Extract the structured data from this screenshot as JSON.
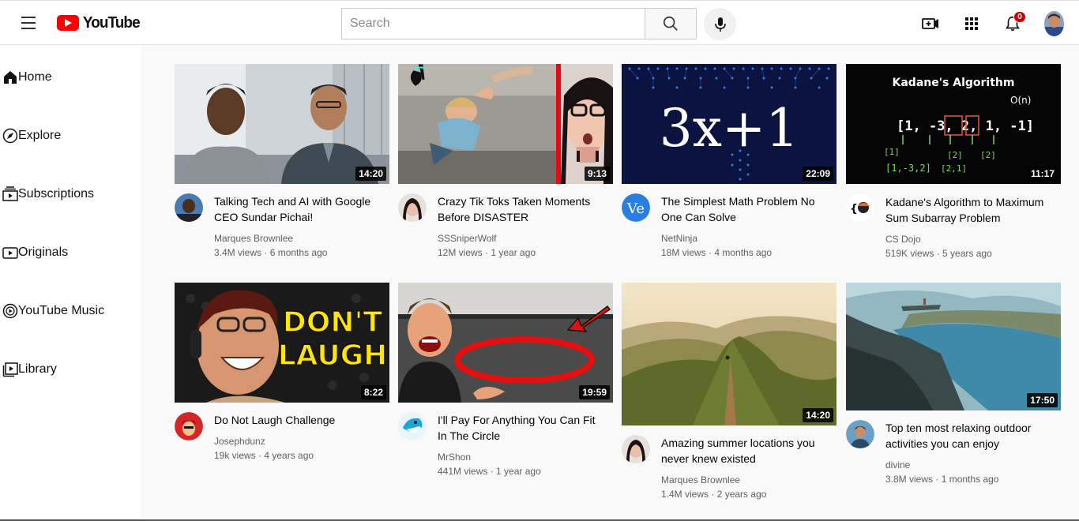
{
  "header": {
    "logo_text": "YouTube",
    "search_placeholder": "Search",
    "notification_count": "0"
  },
  "sidebar": {
    "items": [
      {
        "label": "Home",
        "icon": "home-icon"
      },
      {
        "label": "Explore",
        "icon": "compass-icon"
      },
      {
        "label": "Subscriptions",
        "icon": "subscriptions-icon"
      },
      {
        "label": "Originals",
        "icon": "originals-icon"
      },
      {
        "label": "YouTube Music",
        "icon": "music-icon"
      },
      {
        "label": "Library",
        "icon": "library-icon"
      }
    ]
  },
  "videos": [
    {
      "title": "Talking Tech and AI with Google CEO Sundar Pichai!",
      "channel": "Marques Brownlee",
      "views": "3.4M views",
      "age": "6 months ago",
      "duration": "14:20"
    },
    {
      "title": "Crazy Tik Toks Taken Moments Before DISASTER",
      "channel": "SSSniperWolf",
      "views": "12M views",
      "age": "1 year ago",
      "duration": "9:13"
    },
    {
      "title": "The Simplest Math Problem No One Can Solve",
      "channel": "NetNinja",
      "views": "18M views",
      "age": "4 months ago",
      "duration": "22:09",
      "thumb_text": "3x+1"
    },
    {
      "title": "Kadane's Algorithm to Maximum Sum Subarray Problem",
      "channel": "CS Dojo",
      "views": "519K views",
      "age": "5 years ago",
      "duration": "11:17",
      "thumb_text": "Kadane's Algorithm"
    },
    {
      "title": "Do Not Laugh Challenge",
      "channel": "Josephdunz",
      "views": "19k views",
      "age": "4 years ago",
      "duration": "8:22",
      "thumb_text_1": "DON'T",
      "thumb_text_2": "LAUGH"
    },
    {
      "title": "I'll Pay For Anything You Can Fit In The Circle",
      "channel": "MrShon",
      "views": "441M views",
      "age": "1 year ago",
      "duration": "19:59"
    },
    {
      "title": "Amazing summer locations you never knew existed",
      "channel": "Marques Brownlee",
      "views": "1.4M views",
      "age": "2 years ago",
      "duration": "14:20"
    },
    {
      "title": "Top ten most relaxing outdoor activities you can enjoy",
      "channel": "divine",
      "views": "3.8M views",
      "age": "1 months ago",
      "duration": "17:50"
    }
  ],
  "colors": {
    "brand_red": "#ff0000",
    "notification_red": "#cc0000",
    "text_secondary": "#606060"
  }
}
